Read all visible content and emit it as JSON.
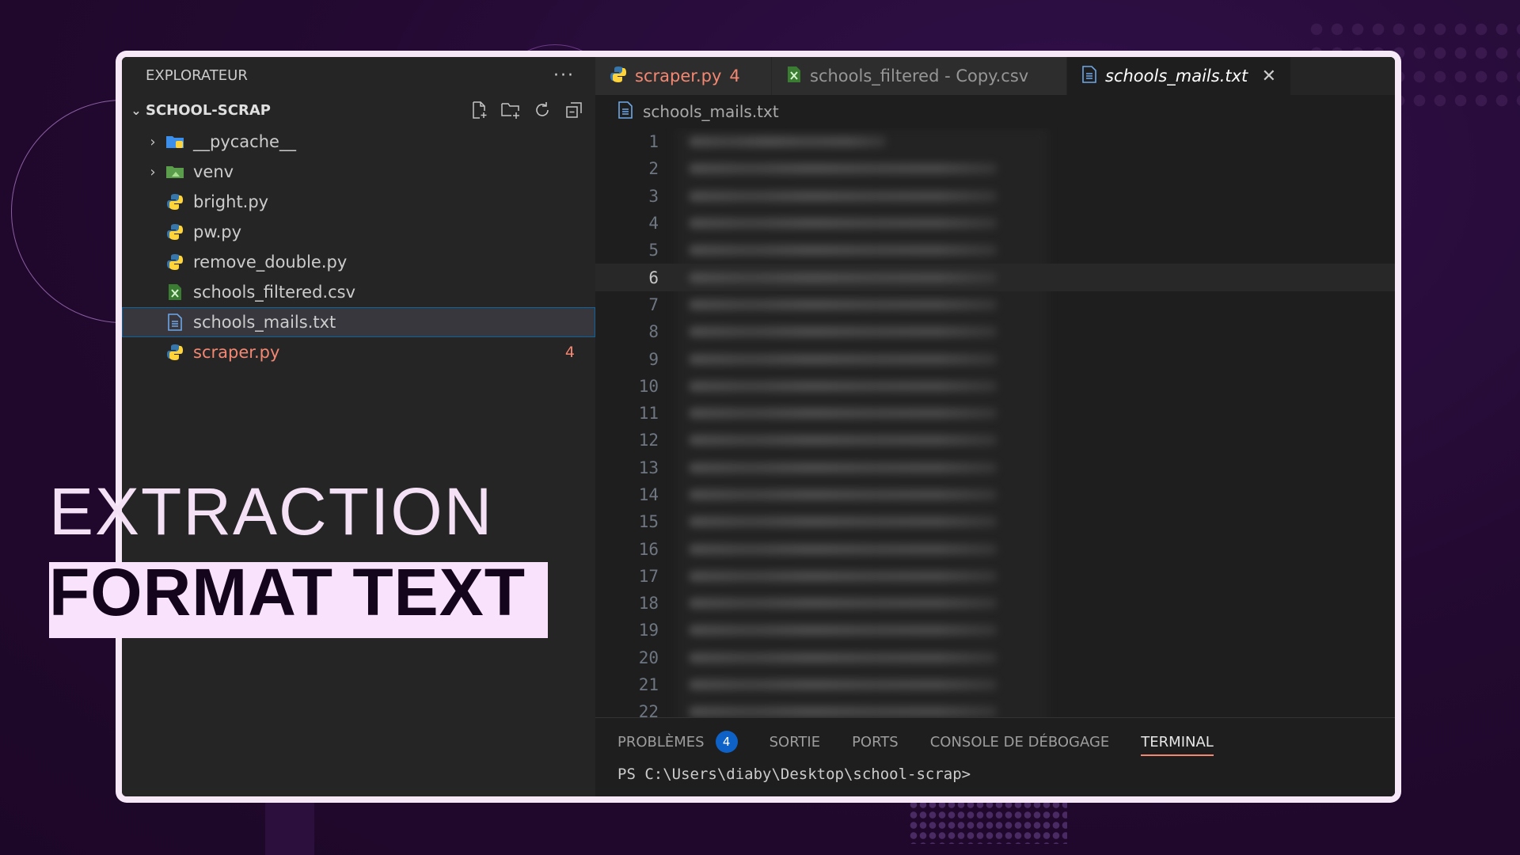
{
  "sidebar": {
    "title": "EXPLORATEUR",
    "more_icon": "ellipsis-icon",
    "project": "SCHOOL-SCRAP",
    "items": [
      {
        "label": "__pycache__",
        "icon": "folder-icon"
      },
      {
        "label": "venv",
        "icon": "folder-icon"
      },
      {
        "label": "bright.py",
        "icon": "python-icon"
      },
      {
        "label": "pw.py",
        "icon": "python-icon"
      },
      {
        "label": "remove_double.py",
        "icon": "python-icon"
      },
      {
        "label": "schools_filtered.csv",
        "icon": "csv-icon"
      },
      {
        "label": "schools_mails.txt",
        "icon": "text-file-icon"
      },
      {
        "label": "scraper.py",
        "icon": "python-icon",
        "problems": "4"
      }
    ]
  },
  "tabs": [
    {
      "label": "scraper.py",
      "count": "4"
    },
    {
      "label": "schools_filtered - Copy.csv"
    },
    {
      "label": "schools_mails.txt",
      "close": "✕"
    }
  ],
  "breadcrumb": "schools_mails.txt",
  "editor": {
    "line_numbers": [
      "1",
      "2",
      "3",
      "4",
      "5",
      "6",
      "7",
      "8",
      "9",
      "10",
      "11",
      "12",
      "13",
      "14",
      "15",
      "16",
      "17",
      "18",
      "19",
      "20",
      "21",
      "22"
    ],
    "current_line": "6"
  },
  "panel": {
    "tabs": [
      "PROBLÈMES",
      "SORTIE",
      "PORTS",
      "CONSOLE DE DÉBOGAGE",
      "TERMINAL"
    ],
    "problems_count": "4",
    "prompt": "PS C:\\Users\\diaby\\Desktop\\school-scrap>"
  },
  "caption": {
    "line1": "EXTRACTION",
    "line2": "FORMAT TEXT"
  },
  "colors": {
    "background": "#22092f",
    "accent": "#f9e2fb",
    "error": "#f48771",
    "badge": "#0e62c7"
  }
}
